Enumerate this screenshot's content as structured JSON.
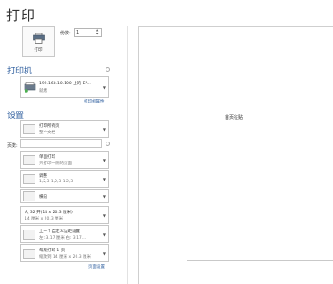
{
  "header": {
    "title": "打印"
  },
  "print": {
    "button_label": "打印",
    "copies_label": "份数:",
    "copies_value": "1"
  },
  "printer": {
    "heading": "打印机",
    "selected_name": "192.168.10.100 上的 EP...",
    "selected_status": "就绪",
    "properties_link": "打印机属性"
  },
  "settings": {
    "heading": "设置",
    "items": [
      {
        "title": "打印所有页",
        "subtitle": "整个文档"
      },
      {
        "title": "单面打印",
        "subtitle": "只打印一侧的页面"
      },
      {
        "title": "调整",
        "subtitle": "1,2,3    1,2,3    1,2,3"
      },
      {
        "title": "横向",
        "subtitle": ""
      },
      {
        "title": "大 32 开(14 x 20.3 厘米)",
        "subtitle": "14 厘米 x 20.3 厘米"
      },
      {
        "title": "上一个自定义边距设置",
        "subtitle": "左: 3.17 厘米   右: 3.17..."
      },
      {
        "title": "每版打印 1 页",
        "subtitle": "缩放到 14 厘米 x 20.3 厘米"
      }
    ],
    "pages_label": "页数:",
    "page_setup_link": "页面设置"
  },
  "preview": {
    "page_text": "首页征贴"
  }
}
